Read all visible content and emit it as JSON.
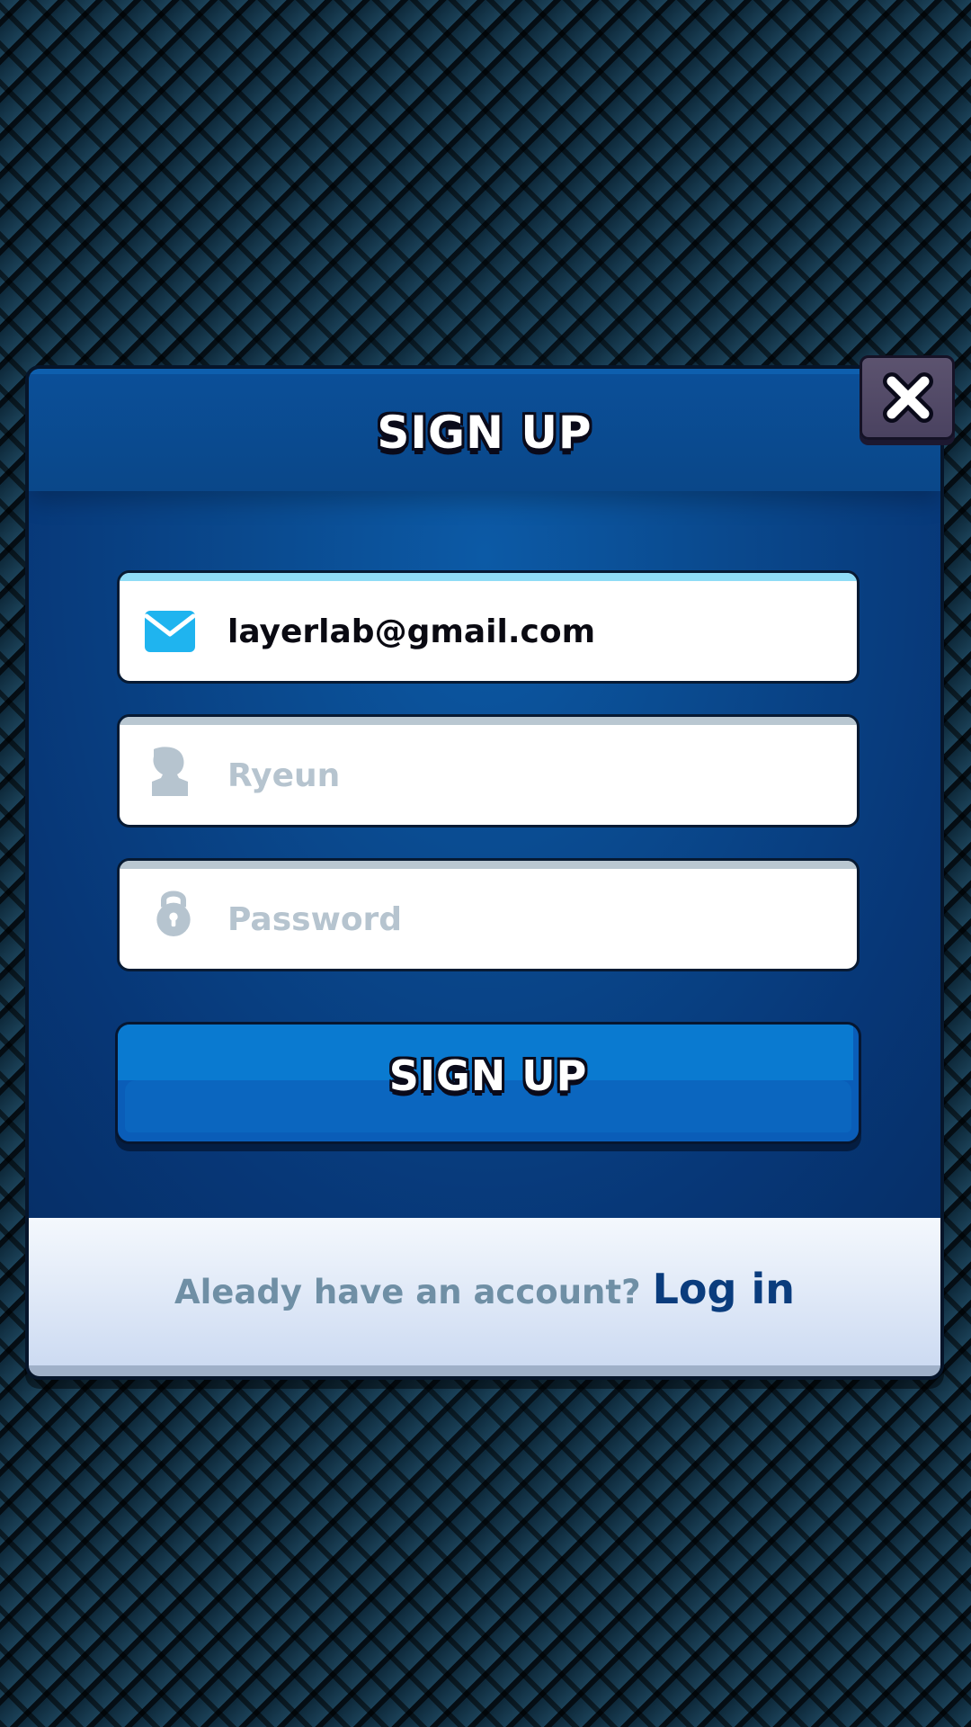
{
  "dialog": {
    "title": "SIGN UP"
  },
  "fields": {
    "email": {
      "icon": "envelope-icon",
      "value": "layerlab@gmail.com",
      "accent": "#8fdcf6"
    },
    "username": {
      "icon": "user-icon",
      "placeholder": "Ryeun"
    },
    "password": {
      "icon": "lock-icon",
      "placeholder": "Password"
    }
  },
  "submit": {
    "label": "SIGN UP"
  },
  "footer": {
    "question": "Aleady have an account?",
    "link": "Log in"
  },
  "close": {
    "icon": "close-icon"
  },
  "colors": {
    "panel": "#0a4a8f",
    "button": "#0a7ad0",
    "link": "#0a3c7d",
    "placeholder": "#b6c4cf",
    "email_icon": "#1fb4ef"
  }
}
